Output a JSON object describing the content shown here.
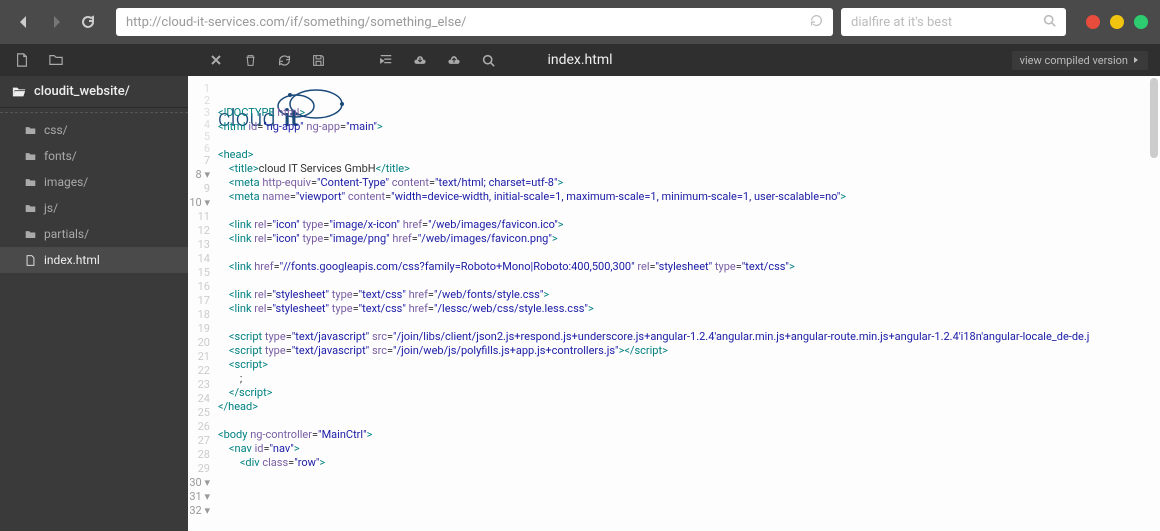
{
  "browser": {
    "url": "http://cloud-it-services.com/if/something/something_else/",
    "search_placeholder": "dialfire at it's best"
  },
  "toolbar": {
    "title": "index.html",
    "compiled_label": "view compiled version"
  },
  "sidebar": {
    "root": "cloudit_website/",
    "items": [
      {
        "label": "css/",
        "type": "folder"
      },
      {
        "label": "fonts/",
        "type": "folder"
      },
      {
        "label": "images/",
        "type": "folder"
      },
      {
        "label": "js/",
        "type": "folder"
      },
      {
        "label": "partials/",
        "type": "folder"
      },
      {
        "label": "index.html",
        "type": "file",
        "selected": true
      }
    ]
  },
  "logo_text": "cloudit",
  "code_lines": [
    {
      "n": 1,
      "html": ""
    },
    {
      "n": 2,
      "html": ""
    },
    {
      "n": 3,
      "html": ""
    },
    {
      "n": 4,
      "html": ""
    },
    {
      "n": 5,
      "html": ""
    },
    {
      "n": 6,
      "html": ""
    },
    {
      "n": 7,
      "html": "<span class='t'>&lt;!DOCTYPE</span> <span class='an'>html</span><span class='t'>&gt;</span>"
    },
    {
      "n": 8,
      "html": "<span class='t'>&lt;html</span> <span class='an'>id</span>=<span class='av'>\"ng-app\"</span> <span class='an'>ng-app</span>=<span class='av'>\"main\"</span><span class='t'>&gt;</span>",
      "mark": true
    },
    {
      "n": 9,
      "html": ""
    },
    {
      "n": 10,
      "html": "<span class='t'>&lt;head&gt;</span>",
      "mark": true
    },
    {
      "n": 11,
      "html": "    <span class='t'>&lt;title&gt;</span>cloud IT Services GmbH<span class='t'>&lt;/title&gt;</span>"
    },
    {
      "n": 12,
      "html": "    <span class='t'>&lt;meta</span> <span class='an'>http-equiv</span>=<span class='av'>\"Content-Type\"</span> <span class='an'>content</span>=<span class='av'>\"text/html; charset=utf-8\"</span><span class='t'>&gt;</span>"
    },
    {
      "n": 13,
      "html": "    <span class='t'>&lt;meta</span> <span class='an'>name</span>=<span class='av'>\"viewport\"</span> <span class='an'>content</span>=<span class='av'>\"width=device-width, initial-scale=1, maximum-scale=1, minimum-scale=1, user-scalable=no\"</span><span class='t'>&gt;</span>"
    },
    {
      "n": 14,
      "html": ""
    },
    {
      "n": 15,
      "html": "    <span class='t'>&lt;link</span> <span class='an'>rel</span>=<span class='av'>\"icon\"</span> <span class='an'>type</span>=<span class='av'>\"image/x-icon\"</span> <span class='an'>href</span>=<span class='av'>\"/web/images/favicon.ico\"</span><span class='t'>&gt;</span>"
    },
    {
      "n": 16,
      "html": "    <span class='t'>&lt;link</span> <span class='an'>rel</span>=<span class='av'>\"icon\"</span> <span class='an'>type</span>=<span class='av'>\"image/png\"</span> <span class='an'>href</span>=<span class='av'>\"/web/images/favicon.png\"</span><span class='t'>&gt;</span>"
    },
    {
      "n": 17,
      "html": ""
    },
    {
      "n": 18,
      "html": "    <span class='t'>&lt;link</span> <span class='an'>href</span>=<span class='av'>\"//fonts.googleapis.com/css?family=Roboto+Mono|Roboto:400,500,300\"</span> <span class='an'>rel</span>=<span class='av'>\"stylesheet\"</span> <span class='an'>type</span>=<span class='av'>\"text/css\"</span><span class='t'>&gt;</span>"
    },
    {
      "n": 19,
      "html": ""
    },
    {
      "n": 20,
      "html": "    <span class='t'>&lt;link</span> <span class='an'>rel</span>=<span class='av'>\"stylesheet\"</span> <span class='an'>type</span>=<span class='av'>\"text/css\"</span> <span class='an'>href</span>=<span class='av'>\"/web/fonts/style.css\"</span><span class='t'>&gt;</span>"
    },
    {
      "n": 21,
      "html": "    <span class='t'>&lt;link</span> <span class='an'>rel</span>=<span class='av'>\"stylesheet\"</span> <span class='an'>type</span>=<span class='av'>\"text/css\"</span> <span class='an'>href</span>=<span class='av'>\"/lessc/web/css/style.less.css\"</span><span class='t'>&gt;</span>"
    },
    {
      "n": 22,
      "html": ""
    },
    {
      "n": 23,
      "html": "    <span class='t'>&lt;script</span> <span class='an'>type</span>=<span class='av'>\"text/javascript\"</span> <span class='an'>src</span>=<span class='av'>\"/join/libs/client/json2.js+respond.js+underscore.js+angular-1.2.4'angular.min.js+angular-route.min.js+angular-1.2.4'i18n'angular-locale_de-de.j</span>"
    },
    {
      "n": 24,
      "html": "    <span class='t'>&lt;script</span> <span class='an'>type</span>=<span class='av'>\"text/javascript\"</span> <span class='an'>src</span>=<span class='av'>\"/join/web/js/polyfills.js+app.js+controllers.js\"</span><span class='t'>&gt;&lt;/script&gt;</span>"
    },
    {
      "n": 25,
      "html": "    <span class='t'>&lt;script&gt;</span>"
    },
    {
      "n": 26,
      "html": "        ;"
    },
    {
      "n": 27,
      "html": "    <span class='t'>&lt;/script&gt;</span>"
    },
    {
      "n": 28,
      "html": "<span class='t'>&lt;/head&gt;</span>"
    },
    {
      "n": 29,
      "html": ""
    },
    {
      "n": 30,
      "html": "<span class='t'>&lt;body</span> <span class='an'>ng-controller</span>=<span class='av'>\"MainCtrl\"</span><span class='t'>&gt;</span>",
      "mark": true
    },
    {
      "n": 31,
      "html": "    <span class='t'>&lt;nav</span> <span class='an'>id</span>=<span class='av'>\"nav\"</span><span class='t'>&gt;</span>",
      "mark": true
    },
    {
      "n": 32,
      "html": "        <span class='t'>&lt;div</span> <span class='an'>class</span>=<span class='av'>\"row\"</span><span class='t'>&gt;</span>",
      "mark": true
    }
  ]
}
